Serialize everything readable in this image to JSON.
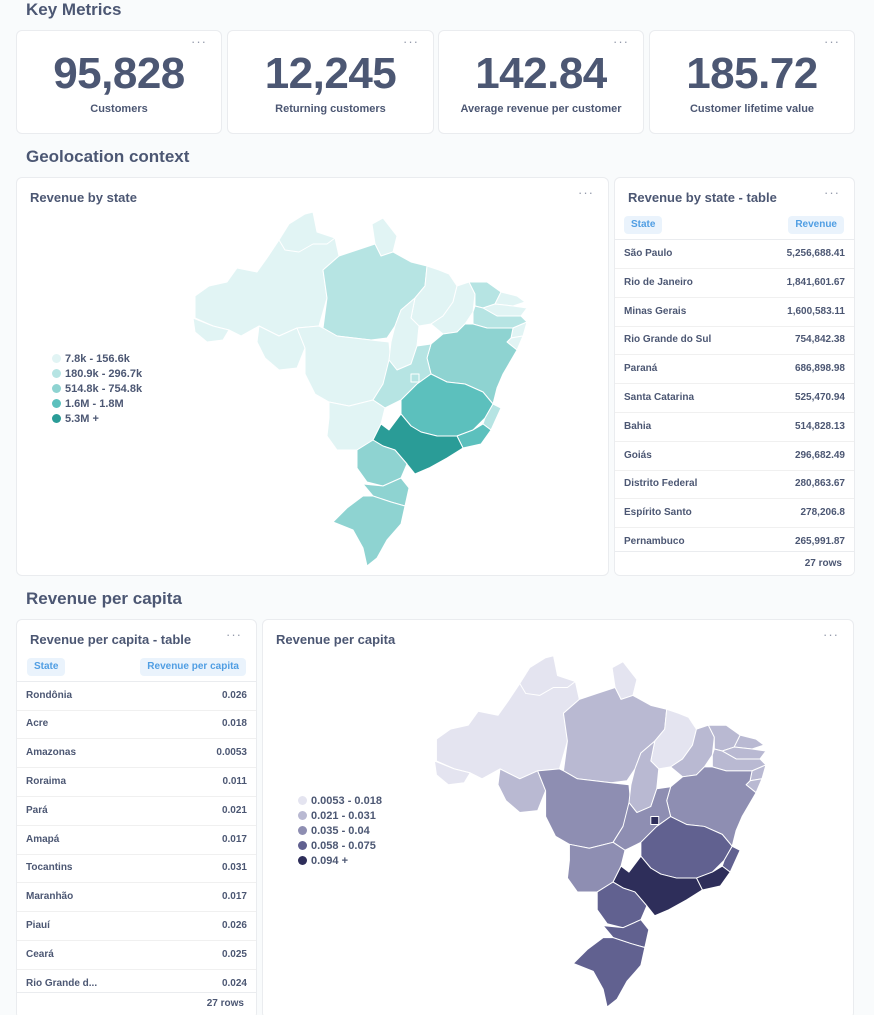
{
  "sections": {
    "key_metrics": "Key Metrics",
    "geolocation": "Geolocation context",
    "per_capita": "Revenue per capita"
  },
  "menu_glyph": "···",
  "metrics": [
    {
      "value": "95,828",
      "label": "Customers"
    },
    {
      "value": "12,245",
      "label": "Returning customers"
    },
    {
      "value": "142.84",
      "label": "Average revenue per customer"
    },
    {
      "value": "185.72",
      "label": "Customer lifetime value"
    }
  ],
  "revenue_map": {
    "title": "Revenue by state",
    "legend": [
      {
        "label": "7.8k - 156.6k",
        "color": "#e1f4f4"
      },
      {
        "label": "180.9k - 296.7k",
        "color": "#b6e4e3"
      },
      {
        "label": "514.8k - 754.8k",
        "color": "#8ed3d1"
      },
      {
        "label": "1.6M - 1.8M",
        "color": "#5cc0bd"
      },
      {
        "label": "5.3M +",
        "color": "#2a9c97"
      }
    ]
  },
  "revenue_table": {
    "title": "Revenue by state - table",
    "col_state": "State",
    "col_value": "Revenue",
    "rows": [
      {
        "state": "São Paulo",
        "value": "5,256,688.41"
      },
      {
        "state": "Rio de Janeiro",
        "value": "1,841,601.67"
      },
      {
        "state": "Minas Gerais",
        "value": "1,600,583.11"
      },
      {
        "state": "Rio Grande do Sul",
        "value": "754,842.38"
      },
      {
        "state": "Paraná",
        "value": "686,898.98"
      },
      {
        "state": "Santa Catarina",
        "value": "525,470.94"
      },
      {
        "state": "Bahia",
        "value": "514,828.13"
      },
      {
        "state": "Goiás",
        "value": "296,682.49"
      },
      {
        "state": "Distrito Federal",
        "value": "280,863.67"
      },
      {
        "state": "Espírito Santo",
        "value": "278,206.8"
      },
      {
        "state": "Pernambuco",
        "value": "265,991.87"
      }
    ],
    "footer": "27 rows"
  },
  "capita_table": {
    "title": "Revenue per capita - table",
    "col_state": "State",
    "col_value": "Revenue per capita",
    "rows": [
      {
        "state": "Rondônia",
        "value": "0.026"
      },
      {
        "state": "Acre",
        "value": "0.018"
      },
      {
        "state": "Amazonas",
        "value": "0.0053"
      },
      {
        "state": "Roraima",
        "value": "0.011"
      },
      {
        "state": "Pará",
        "value": "0.021"
      },
      {
        "state": "Amapá",
        "value": "0.017"
      },
      {
        "state": "Tocantins",
        "value": "0.031"
      },
      {
        "state": "Maranhão",
        "value": "0.017"
      },
      {
        "state": "Piauí",
        "value": "0.026"
      },
      {
        "state": "Ceará",
        "value": "0.025"
      },
      {
        "state": "Rio Grande d...",
        "value": "0.024"
      }
    ],
    "footer": "27 rows"
  },
  "capita_map": {
    "title": "Revenue per capita",
    "legend": [
      {
        "label": "0.0053 - 0.018",
        "color": "#e4e4f0"
      },
      {
        "label": "0.021 - 0.031",
        "color": "#b9b9d2"
      },
      {
        "label": "0.035 - 0.04",
        "color": "#8e8eb2"
      },
      {
        "label": "0.058 - 0.075",
        "color": "#616190"
      },
      {
        "label": "0.094 +",
        "color": "#2e2e5a"
      }
    ]
  }
}
